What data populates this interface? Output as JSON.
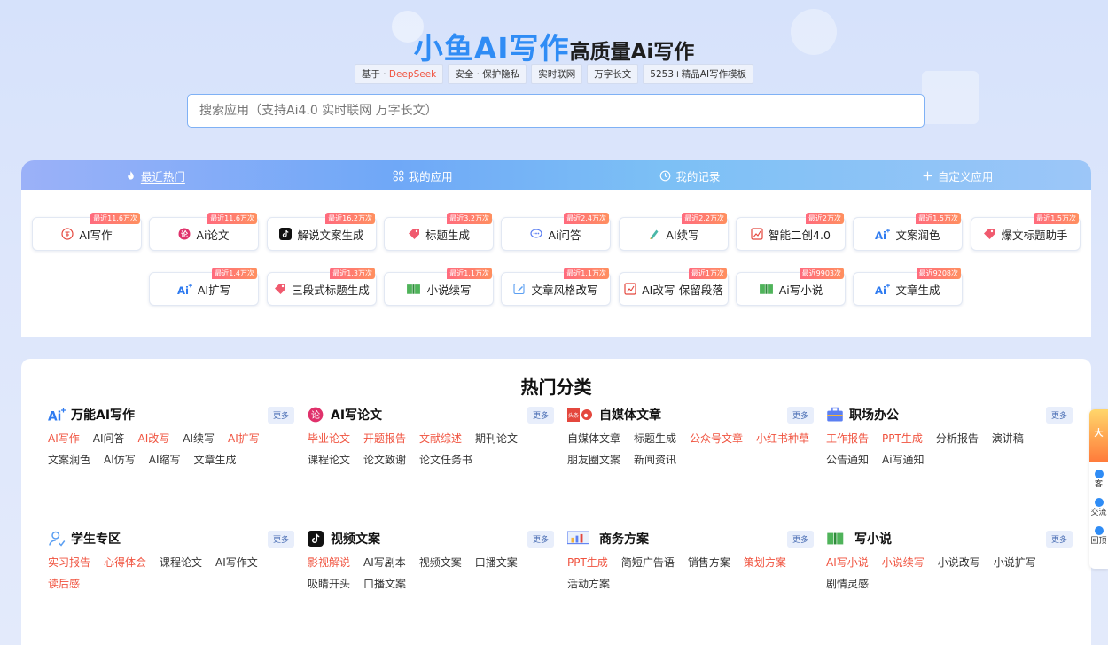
{
  "hero": {
    "brand": "小鱼AI写作",
    "subtitle": "高质量Ai写作"
  },
  "badges": [
    {
      "pre": "基于 · ",
      "hl": "DeepSeek"
    },
    {
      "pre": "安全 · 保护隐私",
      "hl": ""
    },
    {
      "pre": "实时联网",
      "hl": ""
    },
    {
      "pre": "万字长文",
      "hl": ""
    },
    {
      "pre": "5253+精品AI写作模板",
      "hl": ""
    }
  ],
  "search": {
    "placeholder": "搜索应用（支持Ai4.0 实时联网 万字长文）"
  },
  "tabs": [
    "最近热门",
    "我的应用",
    "我的记录",
    "自定义应用"
  ],
  "cards": [
    {
      "label": "AI写作",
      "tag": "最近11.6万次",
      "icon": "write-circle-icon"
    },
    {
      "label": "Ai论文",
      "tag": "最近11.6万次",
      "icon": "paper-icon"
    },
    {
      "label": "解说文案生成",
      "tag": "最近16.2万次",
      "icon": "tiktok-icon"
    },
    {
      "label": "标题生成",
      "tag": "最近3.2万次",
      "icon": "tag-icon"
    },
    {
      "label": "Ai问答",
      "tag": "最近2.4万次",
      "icon": "chat-icon"
    },
    {
      "label": "AI续写",
      "tag": "最近2.2万次",
      "icon": "pen-icon"
    },
    {
      "label": "智能二创4.0",
      "tag": "最近2万次",
      "icon": "edit-chart-icon"
    },
    {
      "label": "文案润色",
      "tag": "最近1.5万次",
      "icon": "ai-sparkle-icon"
    },
    {
      "label": "爆文标题助手",
      "tag": "最近1.5万次",
      "icon": "tag-icon"
    },
    {
      "label": "AI扩写",
      "tag": "最近1.4万次",
      "icon": "ai-sparkle-icon"
    },
    {
      "label": "三段式标题生成",
      "tag": "最近1.3万次",
      "icon": "tag-icon"
    },
    {
      "label": "小说续写",
      "tag": "最近1.1万次",
      "icon": "book-icon"
    },
    {
      "label": "文章风格改写",
      "tag": "最近1.1万次",
      "icon": "edit-icon"
    },
    {
      "label": "AI改写-保留段落",
      "tag": "最近1万次",
      "icon": "edit-chart-icon"
    },
    {
      "label": "Ai写小说",
      "tag": "最近9903次",
      "icon": "book-icon"
    },
    {
      "label": "文章生成",
      "tag": "最近9208次",
      "icon": "ai-sparkle-icon"
    }
  ],
  "categories_title": "热门分类",
  "more_label": "更多",
  "categories": [
    {
      "name": "万能AI写作",
      "icon": "ai-sparkle-icon",
      "items": [
        {
          "t": "AI写作",
          "hot": true
        },
        {
          "t": "AI问答",
          "hot": false
        },
        {
          "t": "AI改写",
          "hot": true
        },
        {
          "t": "AI续写",
          "hot": false
        },
        {
          "t": "AI扩写",
          "hot": true
        },
        {
          "t": "文案润色",
          "hot": false
        },
        {
          "t": "AI仿写",
          "hot": false
        },
        {
          "t": "AI缩写",
          "hot": false
        },
        {
          "t": "文章生成",
          "hot": false
        }
      ]
    },
    {
      "name": "AI写论文",
      "icon": "paper-icon",
      "items": [
        {
          "t": "毕业论文",
          "hot": true
        },
        {
          "t": "开题报告",
          "hot": true
        },
        {
          "t": "文献综述",
          "hot": true
        },
        {
          "t": "期刊论文",
          "hot": false
        },
        {
          "t": "课程论文",
          "hot": false
        },
        {
          "t": "论文致谢",
          "hot": false
        },
        {
          "t": "论文任务书",
          "hot": false
        }
      ]
    },
    {
      "name": "自媒体文章",
      "icon": "media-icon",
      "items": [
        {
          "t": "自媒体文章",
          "hot": false
        },
        {
          "t": "标题生成",
          "hot": false
        },
        {
          "t": "公众号文章",
          "hot": true
        },
        {
          "t": "小红书种草",
          "hot": true
        },
        {
          "t": "朋友圈文案",
          "hot": false
        },
        {
          "t": "新闻资讯",
          "hot": false
        }
      ]
    },
    {
      "name": "职场办公",
      "icon": "briefcase-icon",
      "items": [
        {
          "t": "工作报告",
          "hot": true
        },
        {
          "t": "PPT生成",
          "hot": true
        },
        {
          "t": "分析报告",
          "hot": false
        },
        {
          "t": "演讲稿",
          "hot": false
        },
        {
          "t": "公告通知",
          "hot": false
        },
        {
          "t": "Ai写通知",
          "hot": false
        }
      ]
    },
    {
      "name": "学生专区",
      "icon": "student-icon",
      "items": [
        {
          "t": "实习报告",
          "hot": true
        },
        {
          "t": "心得体会",
          "hot": true
        },
        {
          "t": "课程论文",
          "hot": false
        },
        {
          "t": "AI写作文",
          "hot": false
        },
        {
          "t": "读后感",
          "hot": true
        }
      ]
    },
    {
      "name": "视频文案",
      "icon": "tiktok-icon",
      "items": [
        {
          "t": "影视解说",
          "hot": true
        },
        {
          "t": "AI写剧本",
          "hot": false
        },
        {
          "t": "视频文案",
          "hot": false
        },
        {
          "t": "口播文案",
          "hot": false
        },
        {
          "t": "吸睛开头",
          "hot": false
        },
        {
          "t": "口播文案",
          "hot": false
        }
      ]
    },
    {
      "name": "商务方案",
      "icon": "chart-icon",
      "items": [
        {
          "t": "PPT生成",
          "hot": true
        },
        {
          "t": "简短广告语",
          "hot": false
        },
        {
          "t": "销售方案",
          "hot": false
        },
        {
          "t": "策划方案",
          "hot": true
        },
        {
          "t": "活动方案",
          "hot": false
        }
      ]
    },
    {
      "name": "写小说",
      "icon": "book-icon",
      "items": [
        {
          "t": "AI写小说",
          "hot": true
        },
        {
          "t": "小说续写",
          "hot": true
        },
        {
          "t": "小说改写",
          "hot": false
        },
        {
          "t": "小说扩写",
          "hot": false
        },
        {
          "t": "剧情灵感",
          "hot": false
        }
      ]
    }
  ],
  "side": {
    "promo": "大",
    "items": [
      "客",
      "交流",
      "回顶"
    ]
  },
  "colors": {
    "brand": "#2f8cf5",
    "hot": "#f0533f"
  }
}
